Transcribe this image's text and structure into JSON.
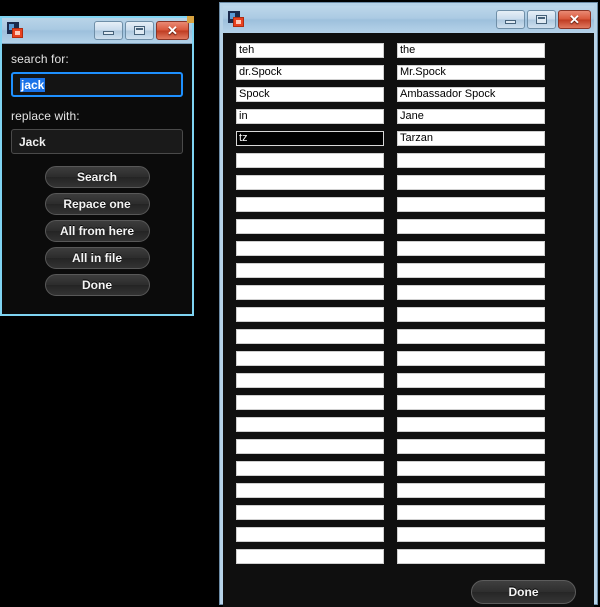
{
  "desktop": {
    "background_color": "#000000"
  },
  "search_replace_dialog": {
    "title": "",
    "icon": "app-icon",
    "window_buttons": {
      "minimize": "–",
      "maximize": "□",
      "close": "✕"
    },
    "search_label": "search for:",
    "search_value": "jack",
    "replace_label": "replace with:",
    "replace_value": "Jack",
    "buttons": [
      {
        "label": "Search"
      },
      {
        "label": "Repace one"
      },
      {
        "label": "All from here"
      },
      {
        "label": "All in file"
      },
      {
        "label": "Done"
      }
    ],
    "accent_border_color": "#7fd4f2"
  },
  "replacements_window": {
    "title": "",
    "icon": "app-icon",
    "window_buttons": {
      "minimize": "–",
      "maximize": "□",
      "close": "✕"
    },
    "done_label": "Done",
    "rows": [
      {
        "find": "teh",
        "replace": "the",
        "focused": false
      },
      {
        "find": "dr.Spock",
        "replace": "Mr.Spock",
        "focused": false
      },
      {
        "find": "Spock",
        "replace": "Ambassador Spock",
        "focused": false
      },
      {
        "find": "in",
        "replace": "Jane",
        "focused": false
      },
      {
        "find": "tz",
        "replace": "Tarzan",
        "focused": true
      },
      {
        "find": "",
        "replace": "",
        "focused": false
      },
      {
        "find": "",
        "replace": "",
        "focused": false
      },
      {
        "find": "",
        "replace": "",
        "focused": false
      },
      {
        "find": "",
        "replace": "",
        "focused": false
      },
      {
        "find": "",
        "replace": "",
        "focused": false
      },
      {
        "find": "",
        "replace": "",
        "focused": false
      },
      {
        "find": "",
        "replace": "",
        "focused": false
      },
      {
        "find": "",
        "replace": "",
        "focused": false
      },
      {
        "find": "",
        "replace": "",
        "focused": false
      },
      {
        "find": "",
        "replace": "",
        "focused": false
      },
      {
        "find": "",
        "replace": "",
        "focused": false
      },
      {
        "find": "",
        "replace": "",
        "focused": false
      },
      {
        "find": "",
        "replace": "",
        "focused": false
      },
      {
        "find": "",
        "replace": "",
        "focused": false
      },
      {
        "find": "",
        "replace": "",
        "focused": false
      },
      {
        "find": "",
        "replace": "",
        "focused": false
      },
      {
        "find": "",
        "replace": "",
        "focused": false
      },
      {
        "find": "",
        "replace": "",
        "focused": false
      },
      {
        "find": "",
        "replace": "",
        "focused": false
      }
    ]
  }
}
